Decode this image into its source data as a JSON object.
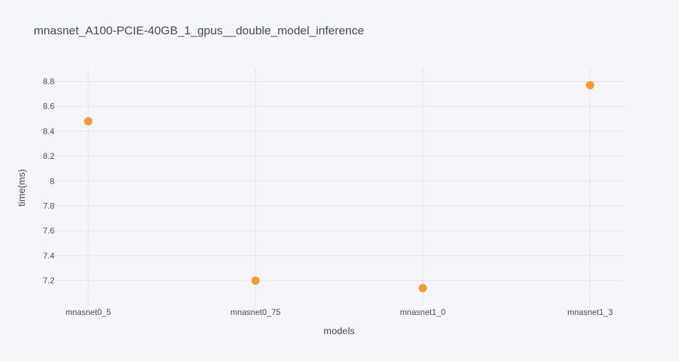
{
  "chart_data": {
    "type": "scatter",
    "title": "mnasnet_A100-PCIE-40GB_1_gpus__double_model_inference",
    "xlabel": "models",
    "ylabel": "time(ms)",
    "categories": [
      "mnasnet0_5",
      "mnasnet0_75",
      "mnasnet1_0",
      "mnasnet1_3"
    ],
    "series": [
      {
        "values": [
          8.48,
          7.2,
          7.14,
          8.77
        ]
      }
    ],
    "yticks": [
      7.2,
      7.4,
      7.6,
      7.8,
      8,
      8.2,
      8.4,
      8.6,
      8.8
    ],
    "ytick_labels": [
      "7.2",
      "7.4",
      "7.6",
      "7.8",
      "8",
      "8.2",
      "8.4",
      "8.6",
      "8.8"
    ],
    "ylim": [
      7.0,
      8.9
    ],
    "grid": true,
    "marker_color": "#fb9a34"
  }
}
